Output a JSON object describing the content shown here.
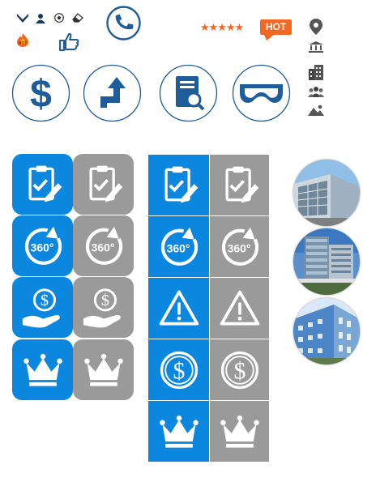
{
  "header": {
    "rating_stars": "★★★★★",
    "hot_badge": "HOT",
    "small_hot_label": "HOT"
  },
  "colors": {
    "accent_blue": "#0c87e0",
    "disabled_gray": "#9a9a9a",
    "outline_blue": "#1f5d9a",
    "hot_orange": "#f26722"
  },
  "icons": {
    "top_row": [
      "military-rank-icon",
      "user-badge-icon",
      "soccer-ball-icon",
      "eraser-icon",
      "thumbs-up-icon",
      "phone-icon",
      "location-pin-icon",
      "museum-icon",
      "building-icon",
      "group-icon",
      "landscape-icon",
      "fire-hot-icon"
    ],
    "circle_row": [
      "dollar-icon",
      "turn-arrow-icon",
      "document-search-icon",
      "vr-goggles-icon"
    ],
    "left_grid": [
      "clipboard-check-icon",
      "rotate-360-icon",
      "money-hand-icon",
      "crown-icon"
    ],
    "right_grid": [
      "clipboard-check-icon",
      "rotate-360-icon",
      "warning-icon",
      "dollar-circle-icon",
      "crown-icon"
    ],
    "photos": [
      "office-building-photo-1",
      "office-building-photo-2",
      "office-building-photo-3"
    ]
  }
}
